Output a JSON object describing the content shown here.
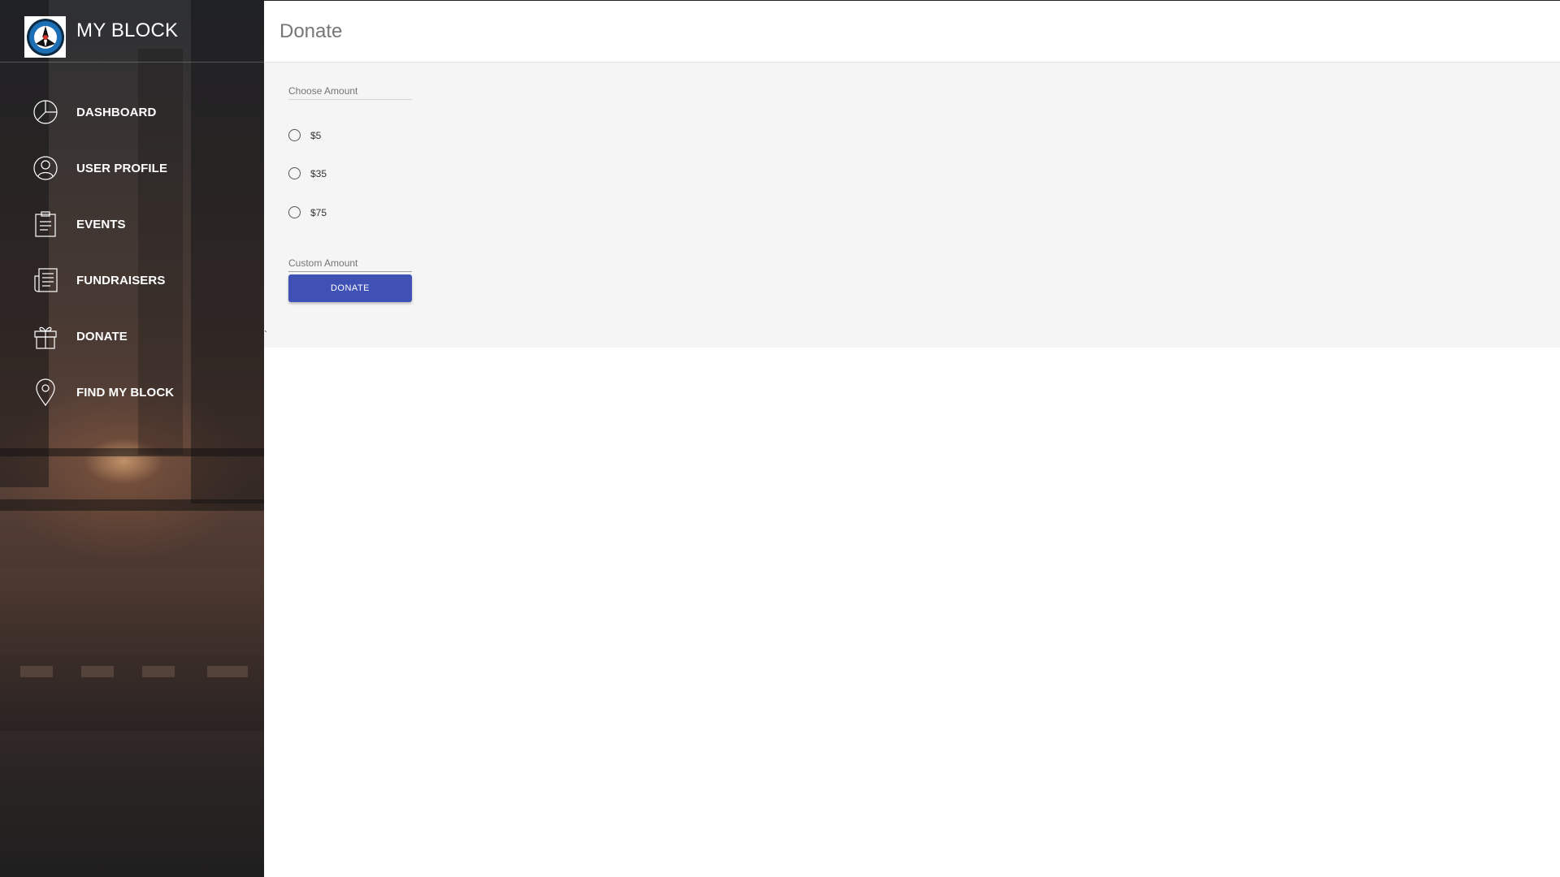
{
  "app": {
    "title": "MY BLOCK"
  },
  "sidebar": {
    "items": [
      {
        "label": "DASHBOARD",
        "icon": "pie-chart-icon"
      },
      {
        "label": "USER PROFILE",
        "icon": "user-icon"
      },
      {
        "label": "EVENTS",
        "icon": "clipboard-icon"
      },
      {
        "label": "FUNDRAISERS",
        "icon": "newspaper-icon"
      },
      {
        "label": "DONATE",
        "icon": "gift-icon"
      },
      {
        "label": "FIND MY BLOCK",
        "icon": "map-pin-icon"
      }
    ]
  },
  "header": {
    "title": "Donate"
  },
  "donate_form": {
    "choose_label": "Choose Amount",
    "options": [
      "$5",
      "$35",
      "$75"
    ],
    "custom_label": "Custom Amount",
    "button_label": "DONATE"
  },
  "misc": {
    "tick": "`"
  },
  "colors": {
    "accent": "#3f51b5",
    "content_bg": "#f5f5f5",
    "title_gray": "#777777"
  }
}
